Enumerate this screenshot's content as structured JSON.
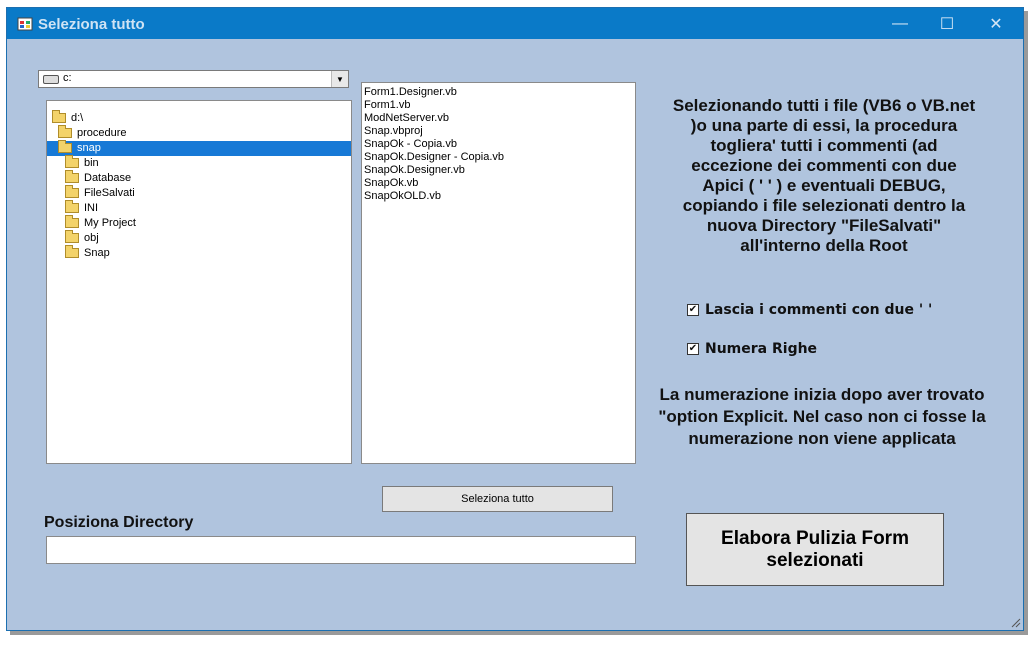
{
  "window": {
    "title": "Seleziona tutto",
    "controls": {
      "minimize": "—",
      "maximize": "☐",
      "close": "✕"
    }
  },
  "drive": {
    "value": "c:",
    "icon": "drive-icon",
    "arrow": "▼"
  },
  "directories": [
    {
      "label": "d:\\",
      "indent": 0,
      "selected": false
    },
    {
      "label": "procedure",
      "indent": 1,
      "selected": false
    },
    {
      "label": "snap",
      "indent": 2,
      "selected": true
    },
    {
      "label": "bin",
      "indent": 3,
      "selected": false
    },
    {
      "label": "Database",
      "indent": 3,
      "selected": false
    },
    {
      "label": "FileSalvati",
      "indent": 3,
      "selected": false
    },
    {
      "label": "INI",
      "indent": 3,
      "selected": false
    },
    {
      "label": "My Project",
      "indent": 3,
      "selected": false
    },
    {
      "label": "obj",
      "indent": 3,
      "selected": false
    },
    {
      "label": "Snap",
      "indent": 3,
      "selected": false
    }
  ],
  "files": [
    "Form1.Designer.vb",
    "Form1.vb",
    "ModNetServer.vb",
    "Snap.vbproj",
    "SnapOk - Copia.vb",
    "SnapOk.Designer - Copia.vb",
    "SnapOk.Designer.vb",
    "SnapOk.vb",
    "SnapOkOLD.vb"
  ],
  "select_all_button": "Seleziona tutto",
  "position": {
    "label": "Posiziona Directory",
    "value": ""
  },
  "info_text": "Selezionando tutti i file (VB6 o VB.net )o una parte di essi, la procedura togliera' tutti i commenti (ad eccezione dei commenti con due Apici  ( ' ' ) e eventuali DEBUG, copiando i file selezionati dentro la nuova Directory \"FileSalvati\" all'interno della Root",
  "checkboxes": [
    {
      "label": "Lascia i commenti con due ' '",
      "checked": true
    },
    {
      "label": "Numera Righe",
      "checked": true
    }
  ],
  "note_text": "La numerazione inizia dopo aver trovato \"option Explicit. Nel caso non ci fosse la numerazione non viene applicata",
  "process_button": "Elabora Pulizia Form selezionati",
  "colors": {
    "window_bg": "#b0c4de",
    "titlebar": "#0a7ac8",
    "selection": "#1779d6"
  }
}
